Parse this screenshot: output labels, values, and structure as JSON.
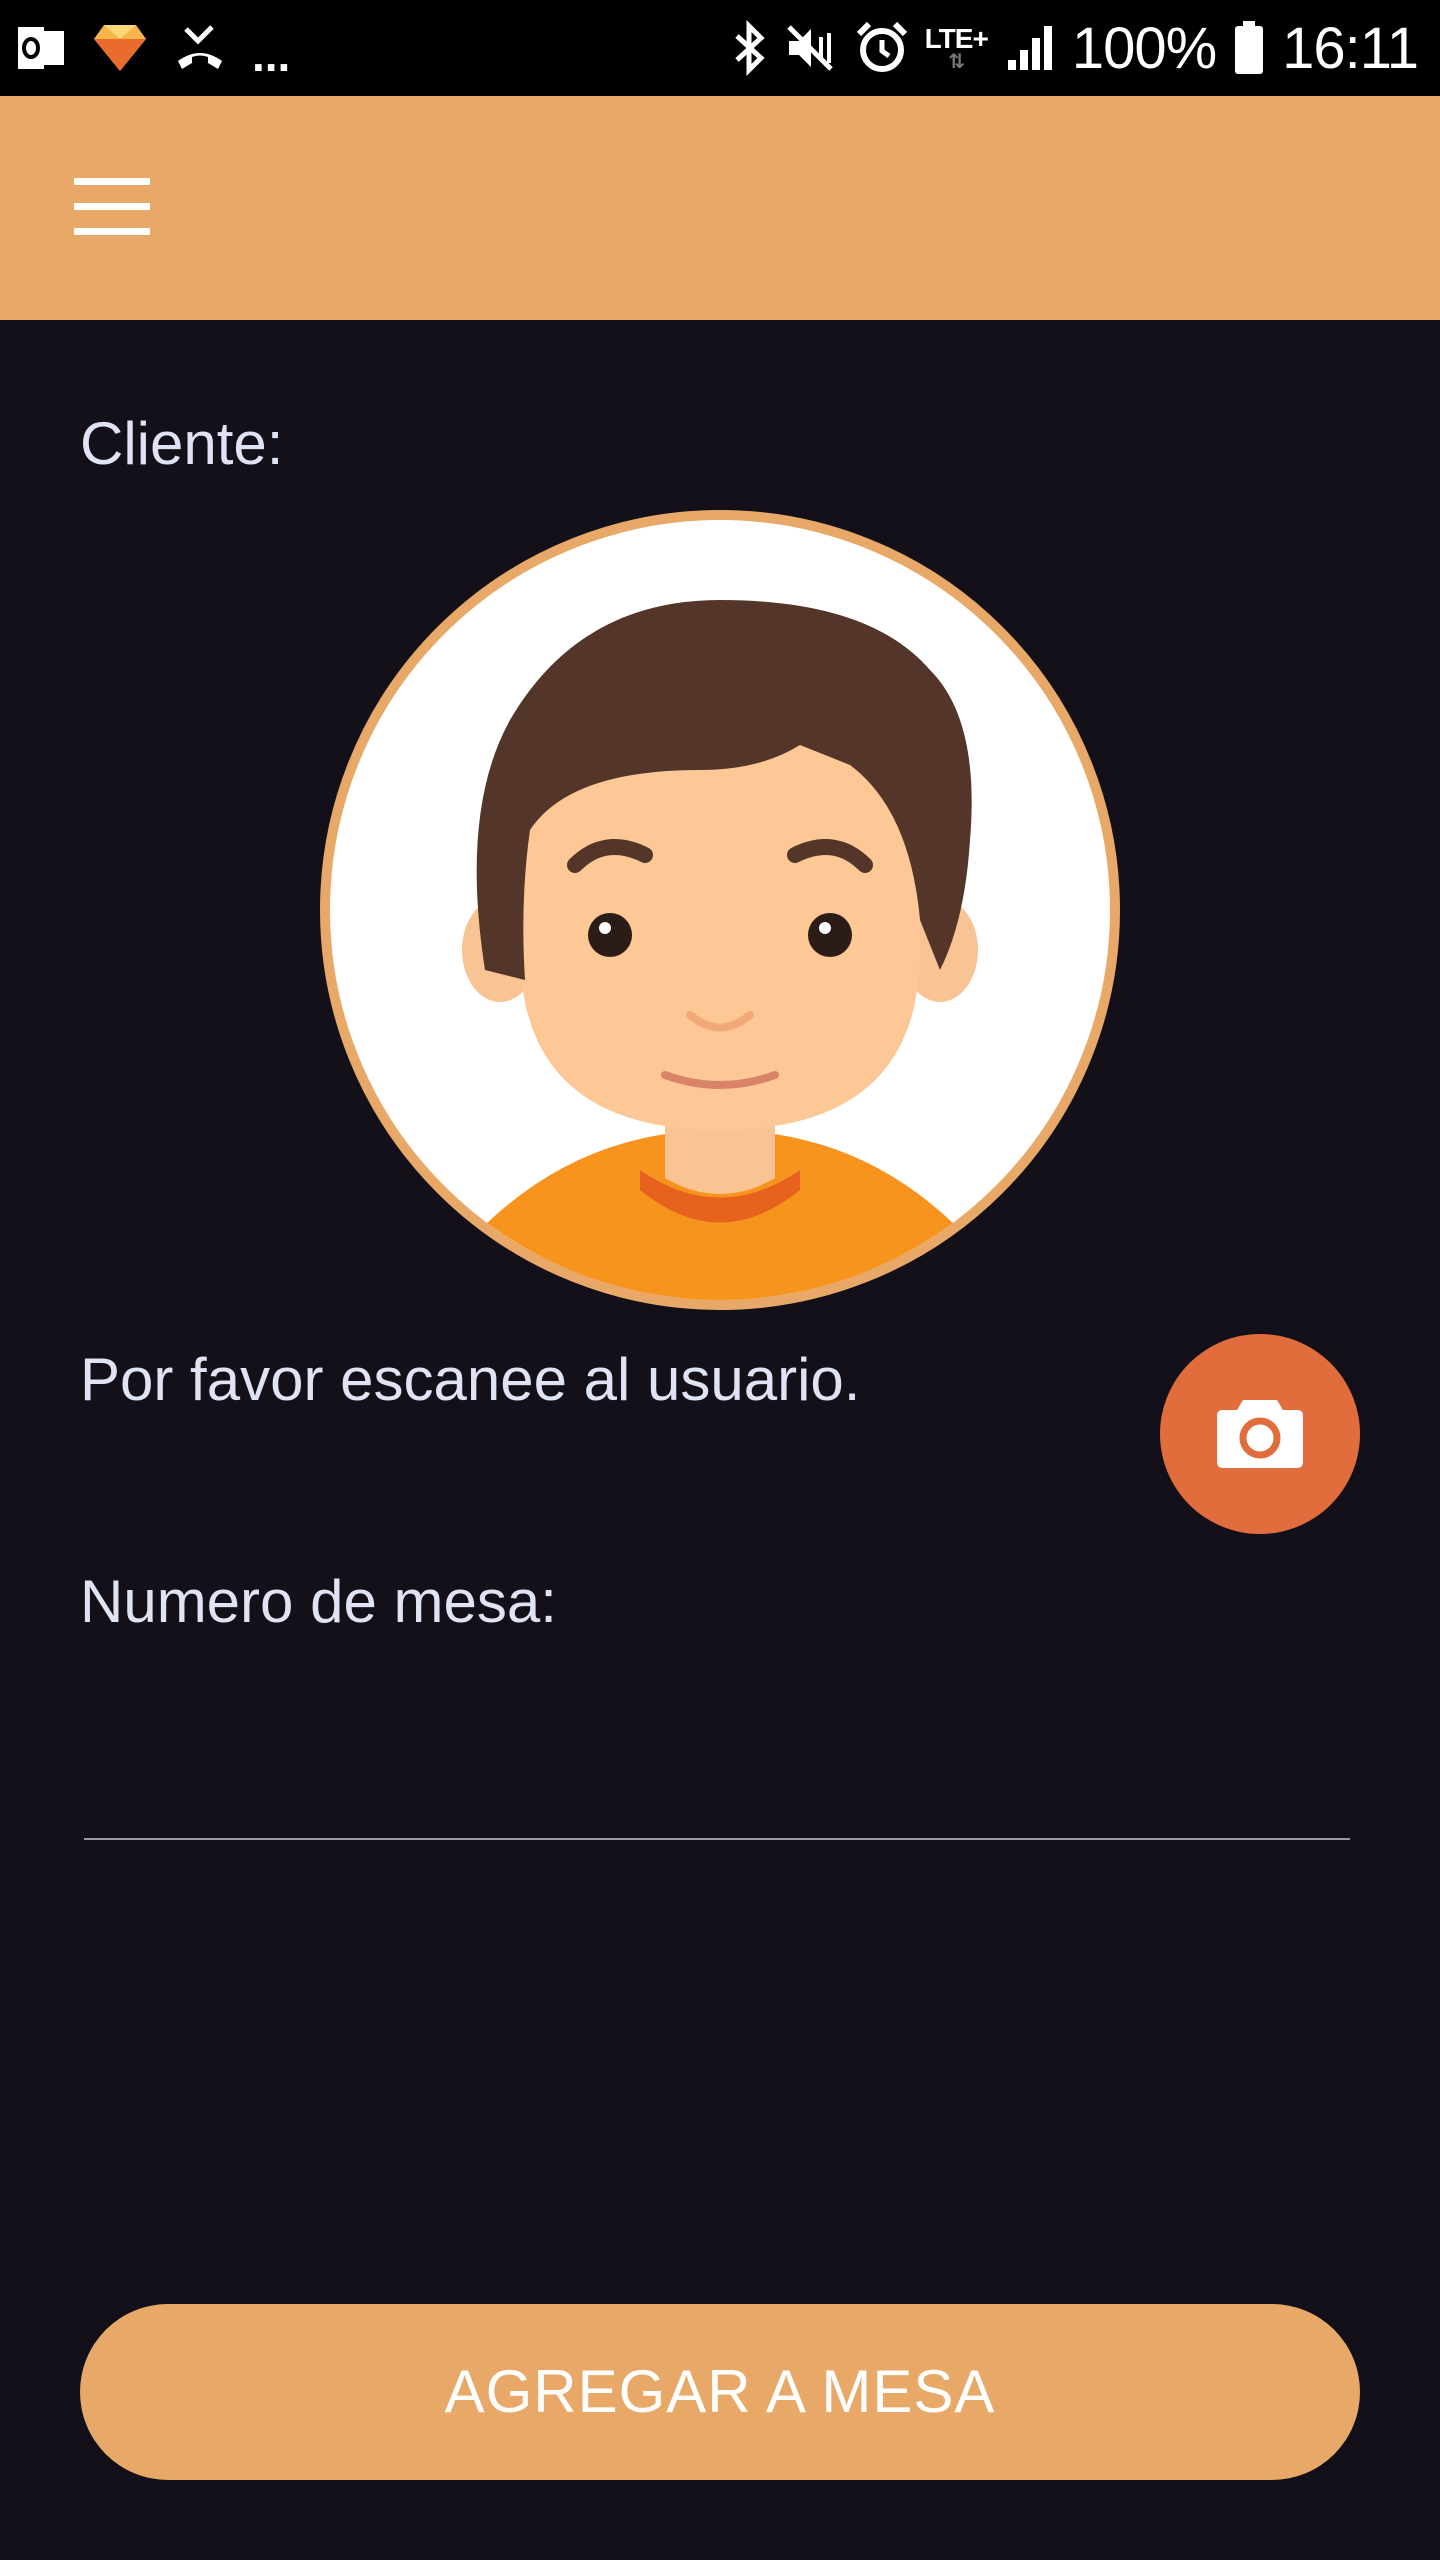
{
  "status_bar": {
    "icons_left": [
      "outlook-icon",
      "sketch-icon",
      "missed-call-icon"
    ],
    "more": "...",
    "icons_right": [
      "bluetooth-icon",
      "vibrate-mute-icon",
      "alarm-icon",
      "signal-icon",
      "battery-icon"
    ],
    "network": "LTE+",
    "battery": "100%",
    "time": "16:11"
  },
  "app_bar": {
    "menu_icon": "hamburger-menu-icon",
    "color": "#e8a968"
  },
  "form": {
    "client_label": "Cliente:",
    "avatar_icon": "user-avatar",
    "scan_prompt": "Por favor escanee al usuario.",
    "camera_icon": "camera-icon",
    "table_label": "Numero de mesa:",
    "table_value": "",
    "submit_label": "AGREGAR A MESA"
  },
  "colors": {
    "background": "#13101a",
    "accent": "#e8a968",
    "fab": "#e06d3b",
    "text": "#dfe3f3"
  }
}
